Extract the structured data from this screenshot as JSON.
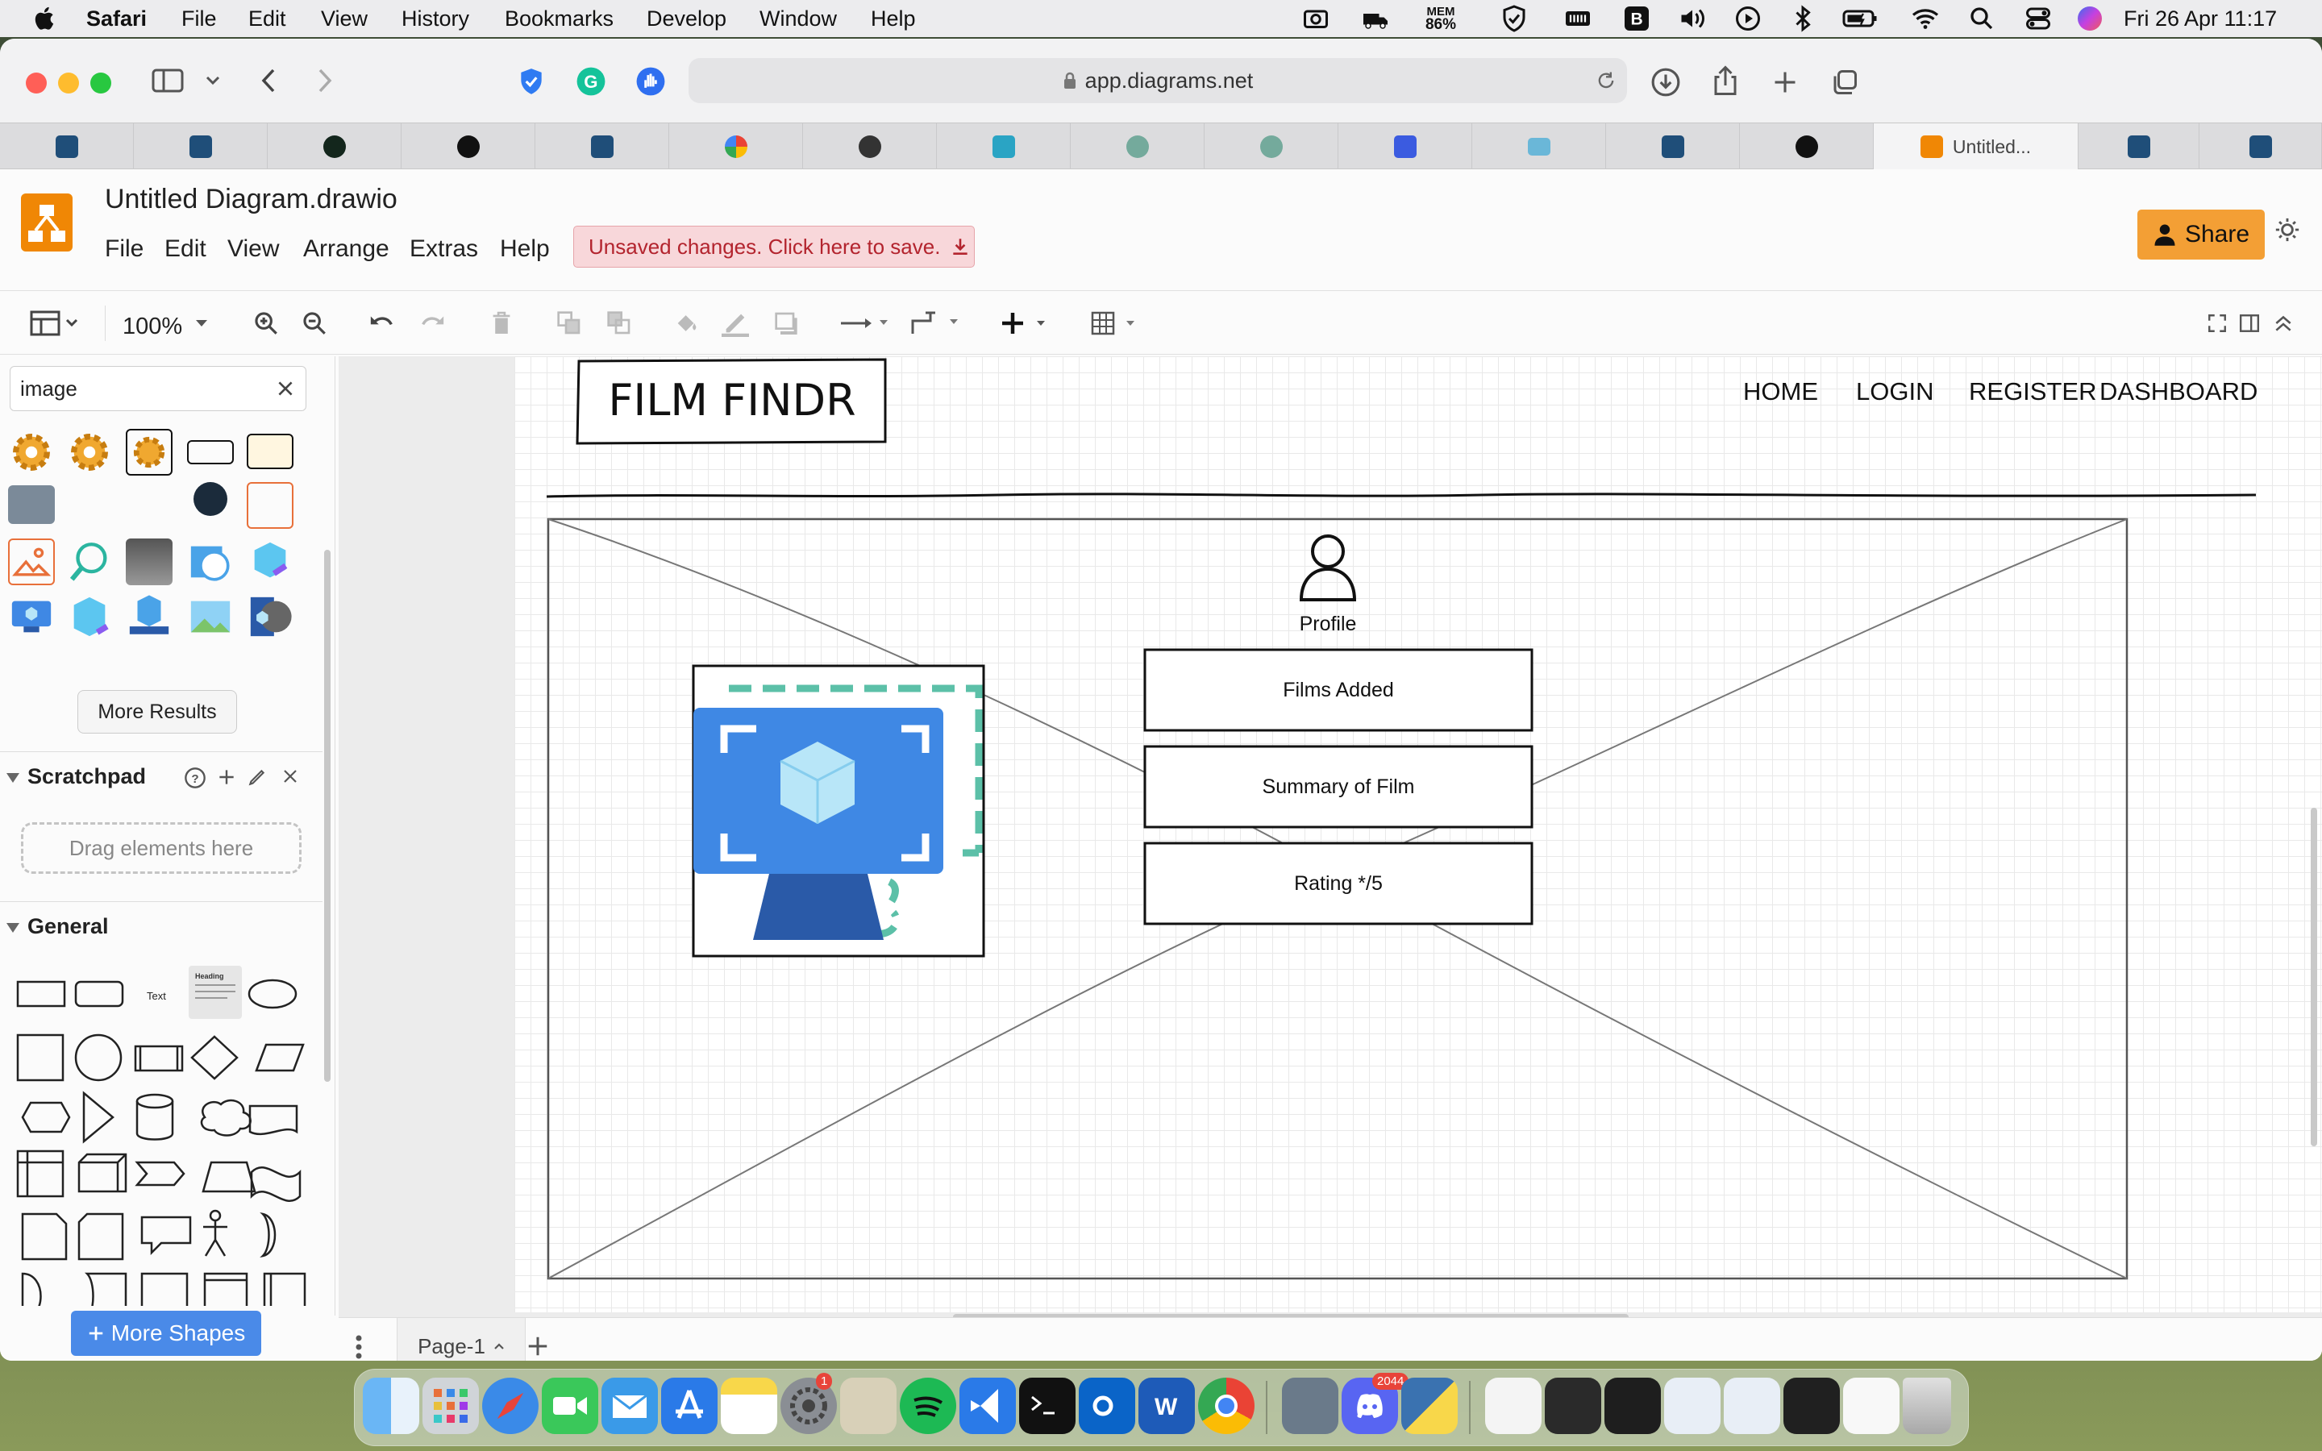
{
  "menubar": {
    "app_name": "Safari",
    "menus": [
      "File",
      "Edit",
      "View",
      "History",
      "Bookmarks",
      "Develop",
      "Window",
      "Help"
    ],
    "mem_label": "MEM",
    "mem_value": "86%",
    "datetime": "Fri 26 Apr  11:17"
  },
  "browser": {
    "url": "app.diagrams.net",
    "active_tab_title": "Untitled..."
  },
  "drawio": {
    "doc_title": "Untitled Diagram.drawio",
    "menus": [
      "File",
      "Edit",
      "View",
      "Arrange",
      "Extras",
      "Help"
    ],
    "unsaved_notice": "Unsaved changes. Click here to save.",
    "share_label": "Share",
    "zoom": "100%",
    "search_value": "image",
    "more_results": "More Results",
    "scratchpad_title": "Scratchpad",
    "scratchpad_drop": "Drag elements here",
    "general_title": "General",
    "more_shapes": "More Shapes",
    "page_tab": "Page-1",
    "palette_text_label": "Text",
    "palette_heading_label": "Heading"
  },
  "diagram": {
    "logo_text": "FILM FINDR",
    "nav": [
      "HOME",
      "LOGIN",
      "REGISTER",
      "DASHBOARD"
    ],
    "profile_label": "Profile",
    "boxes": [
      "Films Added",
      "Summary of Film",
      "Rating */5"
    ]
  },
  "dock": {
    "settings_badge": "1",
    "discord_badge": "2044"
  },
  "colors": {
    "drawio_orange": "#f08705",
    "share_button": "#f39f35",
    "more_shapes_button": "#4a8ae8",
    "unsaved_bg": "#f8d7da",
    "unsaved_text": "#b3242e",
    "azure_blue": "#3f88e4",
    "dashed_teal": "#5cc0a8"
  }
}
